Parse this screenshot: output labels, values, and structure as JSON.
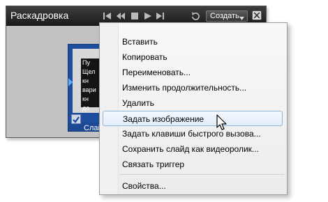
{
  "window": {
    "title": "Раскадровка",
    "create_button": "Создать",
    "controls": [
      "skip-to-start-icon",
      "rewind-icon",
      "stop-icon",
      "play-icon",
      "skip-to-end-icon",
      "loop-icon"
    ]
  },
  "slide": {
    "text_lines": [
      "Пу",
      "Щел",
      "кн",
      "вари",
      "кн",
      "до"
    ],
    "label": "Слай"
  },
  "menu": {
    "items": [
      {
        "label": "Вставить"
      },
      {
        "label": "Копировать"
      },
      {
        "label": "Переименовать..."
      },
      {
        "label": "Изменить продолжительность..."
      },
      {
        "label": "Удалить"
      },
      {
        "label": "Задать изображение",
        "highlighted": true
      },
      {
        "label": "Задать клавиши быстрого вызова..."
      },
      {
        "label": "Сохранить слайд как видеоролик..."
      },
      {
        "label": "Связать триггер"
      },
      {
        "label": "Свойства..."
      }
    ]
  },
  "colors": {
    "titlebar": "#1c1c1c",
    "slide_blue": "#1f4f9c",
    "menu_highlight_border": "#8fb7dd"
  }
}
